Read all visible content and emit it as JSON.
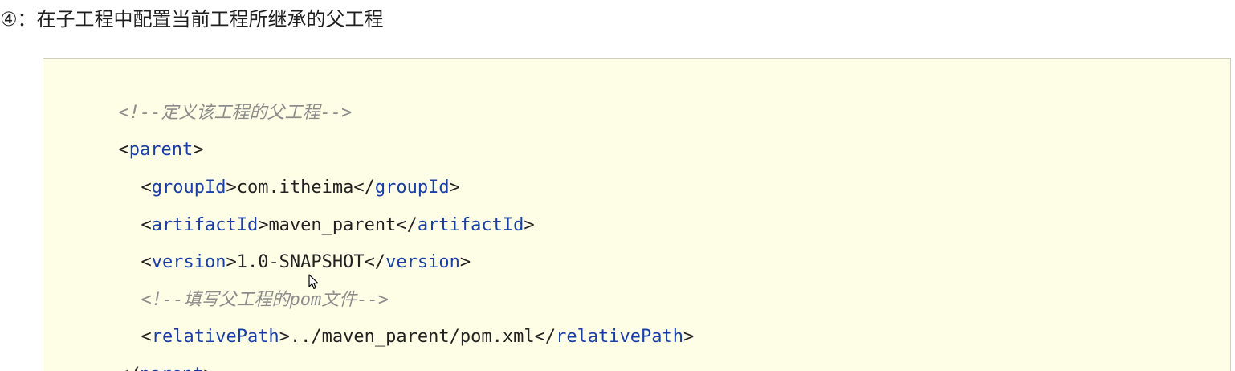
{
  "heading": {
    "marker": "④",
    "text": "：在子工程中配置当前工程所继承的父工程"
  },
  "code": {
    "comment1": "<!--定义该工程的父工程-->",
    "parent_open_lt": "<",
    "parent_tag": "parent",
    "parent_open_gt": ">",
    "groupId_tag": "groupId",
    "groupId_value": "com.itheima",
    "artifactId_tag": "artifactId",
    "artifactId_value": "maven_parent",
    "version_tag": "version",
    "version_value": "1.0-SNAPSHOT",
    "comment2": "<!--填写父工程的pom文件-->",
    "relativePath_tag": "relativePath",
    "relativePath_value": "../maven_parent/pom.xml",
    "parent_close_lt": "</",
    "parent_close_gt": ">",
    "lt": "<",
    "gt": ">",
    "close_lt": "</"
  }
}
